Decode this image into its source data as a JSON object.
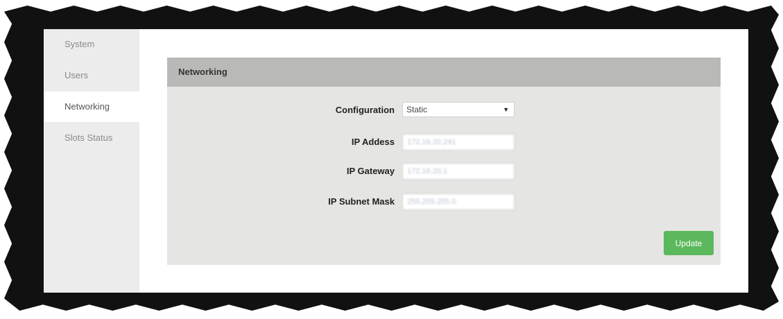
{
  "sidebar": {
    "items": [
      {
        "label": "System",
        "active": false
      },
      {
        "label": "Users",
        "active": false
      },
      {
        "label": "Networking",
        "active": true
      },
      {
        "label": "Slots Status",
        "active": false
      }
    ]
  },
  "panel": {
    "title": "Networking"
  },
  "form": {
    "configuration": {
      "label": "Configuration",
      "value": "Static"
    },
    "ip_address": {
      "label": "IP Addess",
      "value": "172.16.20.241"
    },
    "ip_gateway": {
      "label": "IP Gateway",
      "value": "172.16.20.1"
    },
    "ip_subnet_mask": {
      "label": "IP Subnet Mask",
      "value": "255.255.255.0"
    }
  },
  "actions": {
    "update_label": "Update"
  },
  "colors": {
    "panel_header": "#b9b9b7",
    "panel_body": "#e5e5e3",
    "sidebar": "#ececec",
    "update_button": "#5cb85c",
    "frame": "#111111"
  },
  "icons": {
    "select_arrow": "caret-down-icon"
  }
}
